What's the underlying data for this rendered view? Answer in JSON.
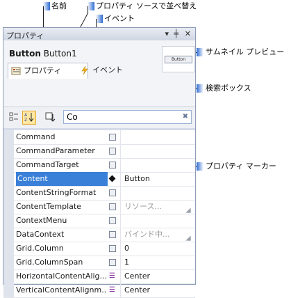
{
  "callouts": {
    "name": "名前",
    "sort_source": "プロパティ ソースで並べ替え",
    "event": "イベント",
    "thumbnail": "サムネイル プレビュー",
    "search_box": "検索ボックス",
    "marker": "プロパティ マーカー"
  },
  "window": {
    "title": "プロパティ",
    "type_name": "Button",
    "element_name": "Button1",
    "thumbnail_label": "Button"
  },
  "tabs": [
    {
      "label": "プロパティ",
      "icon": "properties-icon",
      "active": true
    },
    {
      "label": "イベント",
      "icon": "lightning-icon",
      "active": false
    }
  ],
  "toolbar": {
    "search_value": "Co"
  },
  "properties": [
    {
      "name": "Command",
      "marker": "default",
      "value": ""
    },
    {
      "name": "CommandParameter",
      "marker": "default",
      "value": ""
    },
    {
      "name": "CommandTarget",
      "marker": "default",
      "value": ""
    },
    {
      "name": "Content",
      "marker": "local",
      "value": "Button",
      "selected": true
    },
    {
      "name": "ContentStringFormat",
      "marker": "default",
      "value": ""
    },
    {
      "name": "ContentTemplate",
      "marker": "default",
      "value": "リソース...",
      "muted": true,
      "dropdown": true
    },
    {
      "name": "ContextMenu",
      "marker": "default",
      "value": ""
    },
    {
      "name": "DataContext",
      "marker": "default",
      "value": "バインド中...",
      "muted": true,
      "dropdown": true
    },
    {
      "name": "Grid.Column",
      "marker": "default",
      "value": "0"
    },
    {
      "name": "Grid.ColumnSpan",
      "marker": "default",
      "value": "1"
    },
    {
      "name": "HorizontalContentAlig...",
      "marker": "resource",
      "value": "Center"
    },
    {
      "name": "VerticalContentAlignm...",
      "marker": "resource",
      "value": "Center"
    }
  ]
}
